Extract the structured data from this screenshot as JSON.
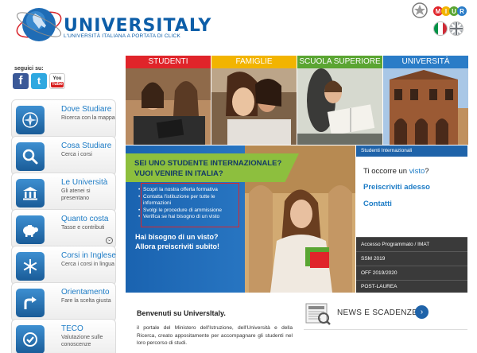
{
  "header": {
    "logo_title": "UNIVERSITALY",
    "logo_subtitle": "L'UNIVERSITÀ ITALIANA A PORTATA DI CLICK",
    "miur_label": "MIUR"
  },
  "social": {
    "title": "seguici su:",
    "facebook": "f",
    "twitter": "t",
    "youtube_you": "You",
    "youtube_tube": "Tube"
  },
  "nav": [
    {
      "title": "Dove Studiare",
      "sub": "Ricerca con la mappa",
      "icon": "compass-icon"
    },
    {
      "title": "Cosa Studiare",
      "sub": "Cerca i corsi",
      "icon": "magnifier-icon"
    },
    {
      "title": "Le Università",
      "sub": "Gli atenei si presentano",
      "icon": "building-icon"
    },
    {
      "title": "Quanto costa",
      "sub": "Tasse e contributi",
      "icon": "piggy-bank-icon"
    },
    {
      "title": "Corsi in Inglese",
      "sub": "Cerca i corsi in lingua",
      "icon": "snowflake-icon"
    },
    {
      "title": "Orientamento",
      "sub": "Fare la scelta giusta",
      "icon": "turn-arrow-icon"
    },
    {
      "title": "TECO",
      "sub": "Valutazione sulle conoscenze",
      "icon": "teco-icon"
    }
  ],
  "categories": [
    {
      "label": "Studenti",
      "color": "#e0242a"
    },
    {
      "label": "Famiglie",
      "color": "#f2b400"
    },
    {
      "label": "Scuola Superiore",
      "color": "#5aa532"
    },
    {
      "label": "Università",
      "color": "#2a7cc7"
    }
  ],
  "banner": {
    "heading_line1": "SEI UNO STUDENTE INTERNAZIONALE?",
    "heading_line2": "VUOI VENIRE IN ITALIA?",
    "items": [
      "Scopri la nostra offerta formativa",
      "Contatta l'istituzione per tutte le informazioni",
      "Svolgi le procedure di ammissione",
      "Verifica se hai bisogno di un visto"
    ],
    "cta_line1": "Hai bisogno di un visto?",
    "cta_line2": "Allora preiscriviti subito!"
  },
  "right_panel": {
    "header": "Studenti Internazionali",
    "visa_prefix": "Ti occorre un",
    "visa_link": "visto",
    "visa_suffix": "?",
    "preiscriviti": "Preiscriviti adesso",
    "contatti": "Contatti",
    "links": [
      "Accesso Programmato / IMAT",
      "SSM 2019",
      "OFF 2019/2020",
      "POST-LAUREA"
    ]
  },
  "welcome": {
    "title": "Benvenuti su UniversItaly.",
    "text": "il portale del Ministero dell'Istruzione, dell'Università e della Ricerca, creato appositamente per accompagnare gli studenti nel loro percorso di studi."
  },
  "news": {
    "label": "NEWS E SCADENZE"
  },
  "colors": {
    "brand_blue": "#1d7cc6",
    "dark_blue": "#1f63a9",
    "green": "#8dbf3e",
    "red": "#e0242a"
  }
}
